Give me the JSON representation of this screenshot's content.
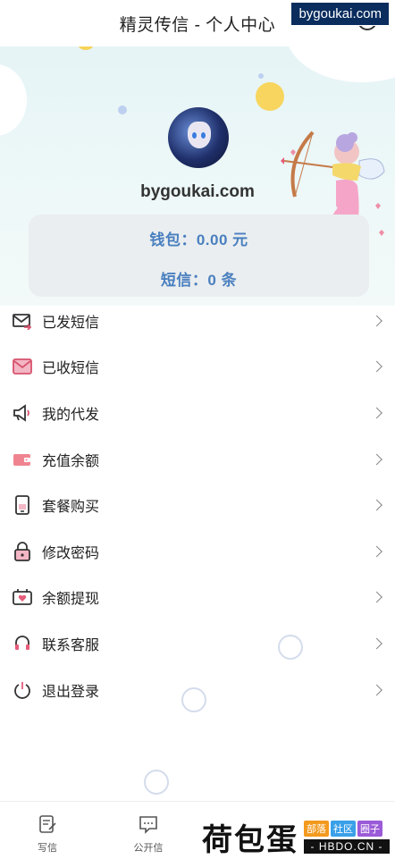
{
  "header": {
    "title": "精灵传信 - 个人中心"
  },
  "watermark_top": "bygoukai.com",
  "profile": {
    "username": "bygoukai.com",
    "wallet": "钱包：0.00 元",
    "sms_count": "短信：0 条"
  },
  "menu": [
    {
      "label": "已发短信",
      "icon": "sent-mail-icon"
    },
    {
      "label": "已收短信",
      "icon": "inbox-mail-icon"
    },
    {
      "label": "我的代发",
      "icon": "megaphone-icon"
    },
    {
      "label": "充值余额",
      "icon": "wallet-icon"
    },
    {
      "label": "套餐购买",
      "icon": "phone-package-icon"
    },
    {
      "label": "修改密码",
      "icon": "lock-icon"
    },
    {
      "label": "余额提现",
      "icon": "withdraw-icon"
    },
    {
      "label": "联系客服",
      "icon": "headset-icon"
    },
    {
      "label": "退出登录",
      "icon": "power-icon"
    }
  ],
  "tabbar": [
    {
      "label": "写信",
      "icon": "write-icon"
    },
    {
      "label": "公开信",
      "icon": "public-letter-icon"
    }
  ],
  "watermark_bottom": {
    "big": "荷包蛋",
    "tags": [
      "部落",
      "社区",
      "圈子"
    ],
    "site": "- HBDO.CN -"
  },
  "colors": {
    "accent": "#4a7fbf",
    "icon_pink": "#d8536e"
  }
}
